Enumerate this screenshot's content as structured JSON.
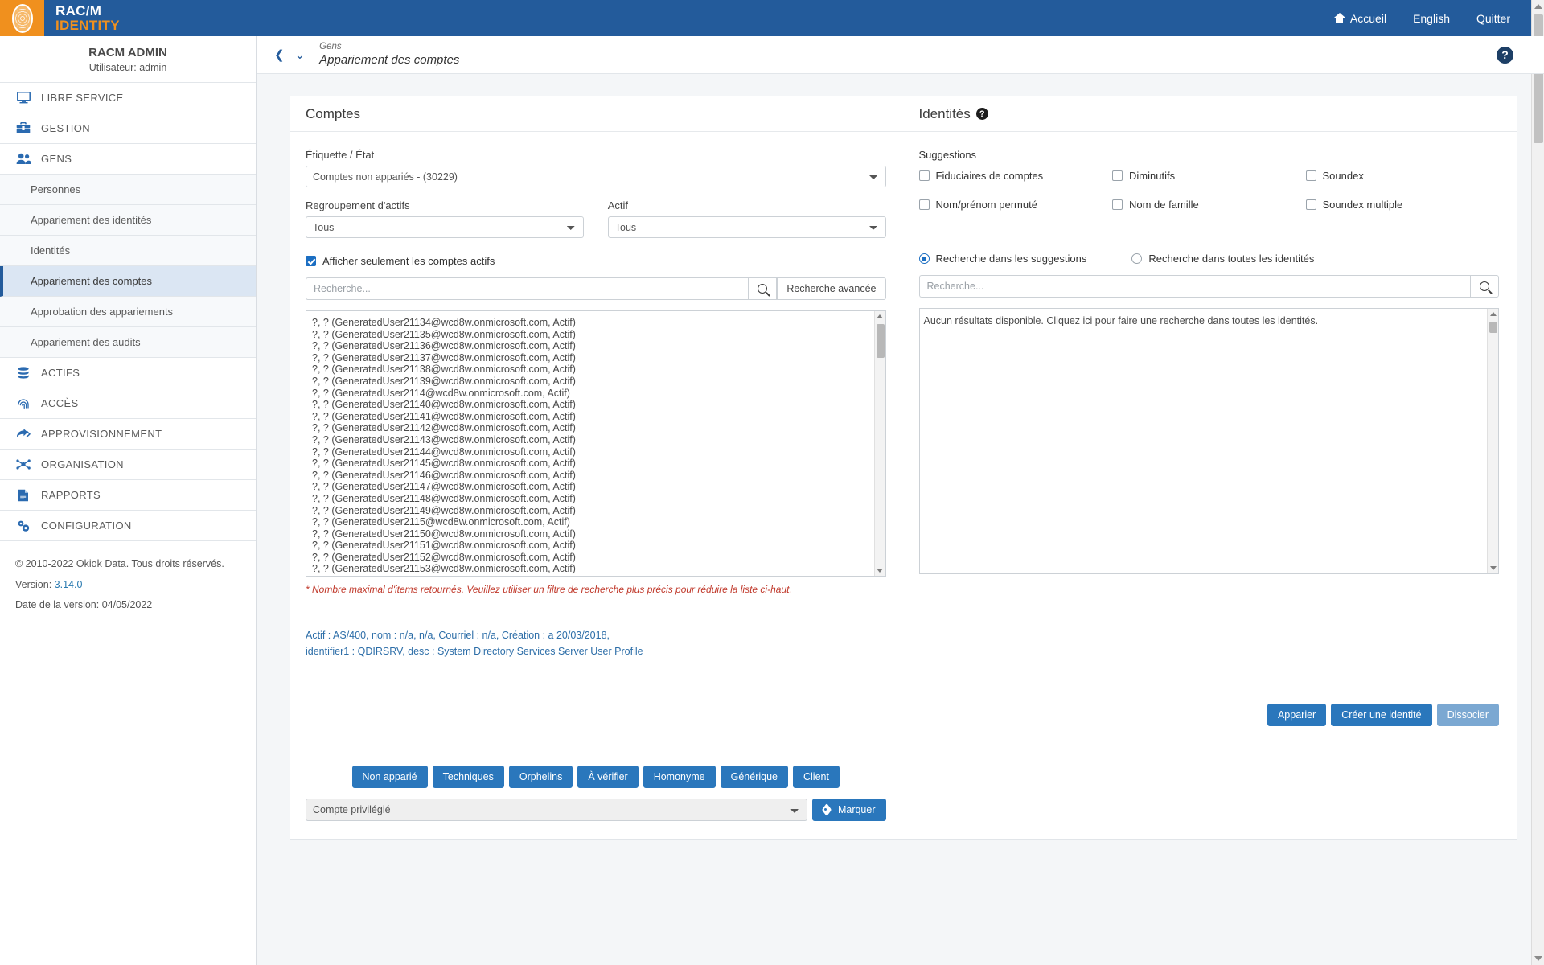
{
  "topbar": {
    "brand_line1": "RAC/M",
    "brand_line2": "IDENTITY",
    "logo_icon": "fingerprint-oval-icon",
    "nav": [
      {
        "label": "Accueil",
        "icon": "home-icon"
      },
      {
        "label": "English",
        "icon": ""
      },
      {
        "label": "Quitter",
        "icon": ""
      }
    ]
  },
  "sidebar": {
    "user_name": "RACM ADMIN",
    "user_sub": "Utilisateur: admin",
    "items": [
      {
        "label": "LIBRE SERVICE",
        "icon": "monitor-icon",
        "type": "main"
      },
      {
        "label": "GESTION",
        "icon": "toolbox-icon",
        "type": "main"
      },
      {
        "label": "GENS",
        "icon": "people-icon",
        "type": "main"
      },
      {
        "label": "Personnes",
        "icon": "",
        "type": "sub"
      },
      {
        "label": "Appariement des identités",
        "icon": "",
        "type": "sub"
      },
      {
        "label": "Identités",
        "icon": "",
        "type": "sub"
      },
      {
        "label": "Appariement des comptes",
        "icon": "",
        "type": "sub",
        "active": true
      },
      {
        "label": "Approbation des appariements",
        "icon": "",
        "type": "sub"
      },
      {
        "label": "Appariement des audits",
        "icon": "",
        "type": "sub"
      },
      {
        "label": "ACTIFS",
        "icon": "database-icon",
        "type": "main"
      },
      {
        "label": "ACCÈS",
        "icon": "fingerprint-icon",
        "type": "main"
      },
      {
        "label": "APPROVISIONNEMENT",
        "icon": "arrows-right-icon",
        "type": "main"
      },
      {
        "label": "ORGANISATION",
        "icon": "org-network-icon",
        "type": "main"
      },
      {
        "label": "RAPPORTS",
        "icon": "document-icon",
        "type": "main"
      },
      {
        "label": "CONFIGURATION",
        "icon": "gears-icon",
        "type": "main"
      }
    ],
    "footer": {
      "copyright": "© 2010-2022 Okiok Data. Tous droits réservés.",
      "version_label": "Version:",
      "version_value": "3.14.0",
      "release_date": "Date de la version: 04/05/2022"
    }
  },
  "breadcrumb": {
    "back_icon": "chevron-left-icon",
    "dropdown_icon": "chevron-down-icon",
    "parent": "Gens",
    "current": "Appariement des comptes",
    "help_icon": "help-icon"
  },
  "accounts": {
    "title": "Comptes",
    "label_state": "Étiquette / État",
    "state_value": "Comptes non appariés - (30229)",
    "label_grouping": "Regroupement d'actifs",
    "grouping_value": "Tous",
    "label_asset": "Actif",
    "asset_value": "Tous",
    "checkbox_active_only": "Afficher seulement les comptes actifs",
    "checkbox_active_only_checked": true,
    "search_placeholder": "Recherche...",
    "search_value": "",
    "search_icon": "search-icon",
    "advanced_search": "Recherche avancée",
    "list": [
      "?, ? (GeneratedUser21134@wcd8w.onmicrosoft.com, Actif)",
      "?, ? (GeneratedUser21135@wcd8w.onmicrosoft.com, Actif)",
      "?, ? (GeneratedUser21136@wcd8w.onmicrosoft.com, Actif)",
      "?, ? (GeneratedUser21137@wcd8w.onmicrosoft.com, Actif)",
      "?, ? (GeneratedUser21138@wcd8w.onmicrosoft.com, Actif)",
      "?, ? (GeneratedUser21139@wcd8w.onmicrosoft.com, Actif)",
      "?, ? (GeneratedUser2114@wcd8w.onmicrosoft.com, Actif)",
      "?, ? (GeneratedUser21140@wcd8w.onmicrosoft.com, Actif)",
      "?, ? (GeneratedUser21141@wcd8w.onmicrosoft.com, Actif)",
      "?, ? (GeneratedUser21142@wcd8w.onmicrosoft.com, Actif)",
      "?, ? (GeneratedUser21143@wcd8w.onmicrosoft.com, Actif)",
      "?, ? (GeneratedUser21144@wcd8w.onmicrosoft.com, Actif)",
      "?, ? (GeneratedUser21145@wcd8w.onmicrosoft.com, Actif)",
      "?, ? (GeneratedUser21146@wcd8w.onmicrosoft.com, Actif)",
      "?, ? (GeneratedUser21147@wcd8w.onmicrosoft.com, Actif)",
      "?, ? (GeneratedUser21148@wcd8w.onmicrosoft.com, Actif)",
      "?, ? (GeneratedUser21149@wcd8w.onmicrosoft.com, Actif)",
      "?, ? (GeneratedUser2115@wcd8w.onmicrosoft.com, Actif)",
      "?, ? (GeneratedUser21150@wcd8w.onmicrosoft.com, Actif)",
      "?, ? (GeneratedUser21151@wcd8w.onmicrosoft.com, Actif)",
      "?, ? (GeneratedUser21152@wcd8w.onmicrosoft.com, Actif)",
      "?, ? (GeneratedUser21153@wcd8w.onmicrosoft.com, Actif)"
    ],
    "warning": "* Nombre maximal d'items retournés. Veuillez utiliser un filtre de recherche plus précis pour réduire la liste ci-haut.",
    "detail_line1": "Actif : AS/400, nom : n/a, n/a, Courriel : n/a, Création : a 20/03/2018,",
    "detail_line2": "identifier1 : QDIRSRV, desc : System Directory Services Server User Profile",
    "buttons": [
      "Non apparié",
      "Techniques",
      "Orphelins",
      "À vérifier",
      "Homonyme",
      "Générique",
      "Client"
    ],
    "mark_select_value": "Compte privilégié",
    "mark_button": "Marquer",
    "mark_icon": "tag-icon"
  },
  "identities": {
    "title": "Identités",
    "title_help_icon": "help-icon",
    "suggestions_label": "Suggestions",
    "suggestions": [
      {
        "label": "Fiduciaires de comptes",
        "checked": false
      },
      {
        "label": "Diminutifs",
        "checked": false
      },
      {
        "label": "Soundex",
        "checked": false
      },
      {
        "label": "Nom/prénom permuté",
        "checked": false
      },
      {
        "label": "Nom de famille",
        "checked": false
      },
      {
        "label": "Soundex multiple",
        "checked": false
      }
    ],
    "radios": [
      {
        "label": "Recherche dans les suggestions",
        "selected": true
      },
      {
        "label": "Recherche dans toutes les identités",
        "selected": false
      }
    ],
    "search_placeholder": "Recherche...",
    "search_value": "",
    "search_icon": "search-icon",
    "empty_message": "Aucun résultats disponible. Cliquez ici pour faire une recherche dans toutes les identités.",
    "buttons": [
      {
        "label": "Apparier",
        "disabled": false
      },
      {
        "label": "Créer une identité",
        "disabled": false
      },
      {
        "label": "Dissocier",
        "disabled": true
      }
    ]
  },
  "colors": {
    "header_blue": "#235b9b",
    "accent_orange": "#f0901e",
    "button_blue": "#2a77bc",
    "active_nav": "#dbe6f3",
    "warning_red": "#c0392b",
    "link_blue": "#2d6ea8"
  }
}
